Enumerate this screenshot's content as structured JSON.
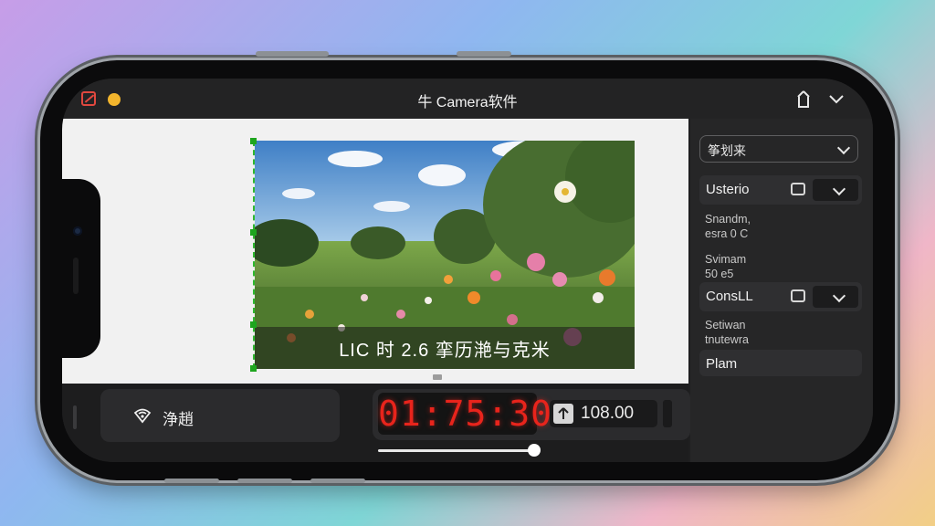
{
  "app": {
    "title": "牛 Camera软件",
    "icons": [
      "app-logo-icon",
      "share-icon",
      "chevron-down-icon"
    ]
  },
  "preview": {
    "caption": "LIC 时 2.6 挛历滟与克米"
  },
  "sidebar": {
    "dropdown_label": "筝划来",
    "rows": [
      {
        "label": "Usterio",
        "stat_line1": "Snandm,",
        "stat_line2": "esra 0 C"
      },
      {
        "label": "Svimam",
        "stat_line2": "50 e5"
      }
    ],
    "row2": {
      "label": "ConsLL"
    },
    "stats2": {
      "line1": "Setiwan",
      "line2": "tnutewra"
    },
    "plain_item": "Plam"
  },
  "controls": {
    "mode_label": "浄趙",
    "timer": "01:75:30",
    "zoom_value": "108.00",
    "slider_value": 0.95
  },
  "colors": {
    "timer_red": "#e8241c",
    "accent_yellow": "#f3b52d",
    "selection_green": "#1ea51e"
  }
}
